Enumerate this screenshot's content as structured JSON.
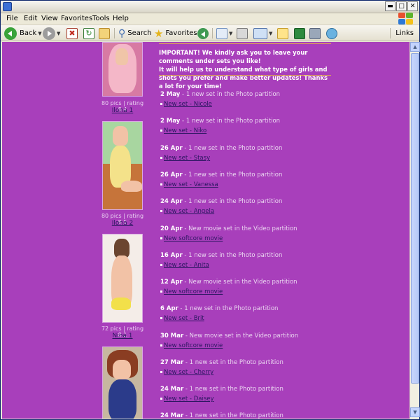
{
  "menu": [
    "File",
    "Edit",
    "View",
    "Favorites",
    "Tools",
    "Help"
  ],
  "toolbar": {
    "back": "Back",
    "search": "Search",
    "favorites": "Favorites",
    "links": "Links"
  },
  "notice": {
    "line1": "IMPORTANT! We kindly ask you to leave your comments under sets you like!",
    "line2": "It will help us to understand what type of girls and shots you prefer and make better updates! Thanks a lot for your time!"
  },
  "models": [
    {
      "caption": "80 pics | rating 8.4",
      "name": "Ilona 1"
    },
    {
      "caption": "80 pics | rating 8.5",
      "name": "Ilona 2"
    },
    {
      "caption": "72 pics | rating 8.1",
      "name": "Nina 1"
    }
  ],
  "news": [
    {
      "date": "2 May",
      "text": " - 1 new set in the Photo partition",
      "link": "New set - Nicole"
    },
    {
      "date": "2 May",
      "text": " - 1 new set in the Photo partition",
      "link": "New set - Niko"
    },
    {
      "date": "26 Apr",
      "text": " - 1 new set in the Photo partition",
      "link": "New set - Stasy"
    },
    {
      "date": "26 Apr",
      "text": " - 1 new set in the Photo partition",
      "link": "New set - Vanessa"
    },
    {
      "date": "24 Apr",
      "text": " - 1 new set in the Photo partition",
      "link": "New set - Angela"
    },
    {
      "date": "20 Apr",
      "text": " - New movie set in the Video partition",
      "link": "New softcore movie"
    },
    {
      "date": "16 Apr",
      "text": " - 1 new set in the Photo partition",
      "link": "New set - Anita"
    },
    {
      "date": "12 Apr",
      "text": " - New movie set in the Video partition",
      "link": "New softcore movie"
    },
    {
      "date": "6 Apr",
      "text": " - 1 new set in the Photo partition",
      "link": "New set - Brit"
    },
    {
      "date": "30 Mar",
      "text": " - New movie set in the Video partition",
      "link": "New softcore movie"
    },
    {
      "date": "27 Mar",
      "text": " - 1 new set in the Photo partition",
      "link": "New set - Cherry"
    },
    {
      "date": "24 Mar",
      "text": " - 1 new set in the Photo partition",
      "link": "New set - Daisey"
    },
    {
      "date": "24 Mar",
      "text": " - 1 new set in the Photo partition",
      "link": ""
    }
  ],
  "colors": {
    "page_bg": "#a83fbb",
    "link": "#2a1660",
    "rule": "#e4b24a"
  }
}
